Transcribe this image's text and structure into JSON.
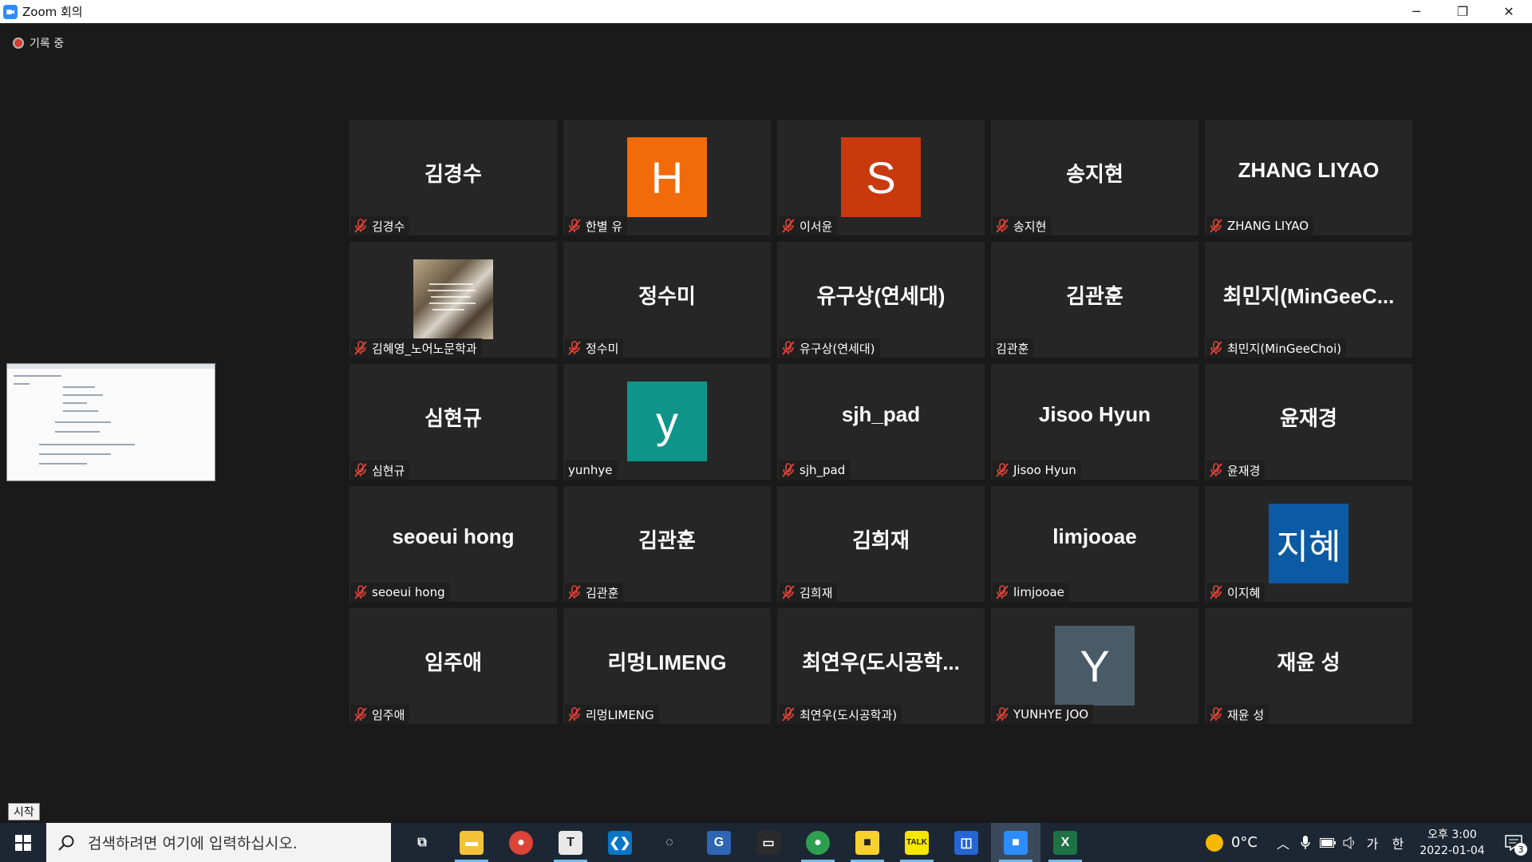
{
  "window": {
    "title": "Zoom 회의",
    "controls": {
      "minimize": "─",
      "restore": "❐",
      "close": "✕"
    }
  },
  "recording": {
    "label": "기록 중"
  },
  "tiles": [
    {
      "display": "김경수",
      "label": "김경수",
      "muted": true,
      "type": "name"
    },
    {
      "display": "H",
      "label": "한별 유",
      "muted": true,
      "type": "avatar",
      "color": "#f26b0b"
    },
    {
      "display": "S",
      "label": "이서윤",
      "muted": true,
      "type": "avatar",
      "color": "#c8390e"
    },
    {
      "display": "송지현",
      "label": "송지현",
      "muted": true,
      "type": "name"
    },
    {
      "display": "ZHANG LIYAO",
      "label": "ZHANG LIYAO",
      "muted": true,
      "type": "name"
    },
    {
      "display": "",
      "label": "김혜영_노어노문학과",
      "muted": true,
      "type": "photo"
    },
    {
      "display": "정수미",
      "label": "정수미",
      "muted": true,
      "type": "name"
    },
    {
      "display": "유구상(연세대)",
      "label": "유구상(연세대)",
      "muted": true,
      "type": "name"
    },
    {
      "display": "김관훈",
      "label": "김관훈",
      "muted": false,
      "type": "name"
    },
    {
      "display": "최민지(MinGeeC...",
      "label": "최민지(MinGeeChoi)",
      "muted": true,
      "type": "name"
    },
    {
      "display": "심현규",
      "label": "심현규",
      "muted": true,
      "type": "name"
    },
    {
      "display": "y",
      "label": "yunhye",
      "muted": false,
      "type": "avatar",
      "color": "#0e9488"
    },
    {
      "display": "sjh_pad",
      "label": "sjh_pad",
      "muted": true,
      "type": "name"
    },
    {
      "display": "Jisoo Hyun",
      "label": "Jisoo Hyun",
      "muted": true,
      "type": "name"
    },
    {
      "display": "윤재경",
      "label": "윤재경",
      "muted": true,
      "type": "name"
    },
    {
      "display": "seoeui hong",
      "label": "seoeui hong",
      "muted": true,
      "type": "name"
    },
    {
      "display": "김관훈",
      "label": "김관훈",
      "muted": true,
      "type": "name"
    },
    {
      "display": "김희재",
      "label": "김희재",
      "muted": true,
      "type": "name"
    },
    {
      "display": "limjooae",
      "label": "limjooae",
      "muted": true,
      "type": "name"
    },
    {
      "display": "지혜",
      "label": "이지혜",
      "muted": true,
      "type": "avatar",
      "color": "#0b5aa3"
    },
    {
      "display": "임주애",
      "label": "임주애",
      "muted": true,
      "type": "name"
    },
    {
      "display": "리멍LIMENG",
      "label": "리멍LIMENG",
      "muted": true,
      "type": "name"
    },
    {
      "display": "최연우(도시공학...",
      "label": "최연우(도시공학과)",
      "muted": true,
      "type": "name"
    },
    {
      "display": "Y",
      "label": "YUNHYE JOO",
      "muted": true,
      "type": "avatar",
      "color": "#4a5b68"
    },
    {
      "display": "재윤 성",
      "label": "재윤 성",
      "muted": true,
      "type": "name"
    }
  ],
  "tooltip": {
    "text": "시작"
  },
  "taskbar": {
    "search_placeholder": "검색하려면 여기에 입력하십시오.",
    "apps": [
      {
        "name": "task-view",
        "glyph": "⧉",
        "color": "transparent",
        "active": false
      },
      {
        "name": "file-explorer",
        "glyph": "▬",
        "color": "#f2c23a",
        "active": true
      },
      {
        "name": "chrome",
        "glyph": "●",
        "color": "#db4437",
        "active": false
      },
      {
        "name": "typora",
        "glyph": "T",
        "color": "#e9e9e9",
        "active": true
      },
      {
        "name": "vscode",
        "glyph": "❮❯",
        "color": "#0a74c7",
        "active": false
      },
      {
        "name": "jupyter",
        "glyph": "◌",
        "color": "transparent",
        "active": false
      },
      {
        "name": "gpa-app",
        "glyph": "G",
        "color": "#2f66b3",
        "active": false
      },
      {
        "name": "terminal",
        "glyph": "▭",
        "color": "#2b2b2b",
        "active": false
      },
      {
        "name": "chrome-profile",
        "glyph": "●",
        "color": "#2e9e4f",
        "active": true
      },
      {
        "name": "sticky-notes",
        "glyph": "■",
        "color": "#f8d12f",
        "active": true
      },
      {
        "name": "kakaotalk",
        "glyph": "TALK",
        "color": "#f7e600",
        "active": true
      },
      {
        "name": "remote-app",
        "glyph": "◫",
        "color": "#2565d4",
        "active": false
      },
      {
        "name": "zoom",
        "glyph": "■",
        "color": "#2d8cff",
        "active": true
      },
      {
        "name": "excel",
        "glyph": "X",
        "color": "#1f7246",
        "active": true
      }
    ],
    "weather": {
      "temp": "0°C"
    },
    "tray": {
      "ime": "가",
      "lang": "한"
    },
    "clock": {
      "time": "오후 3:00",
      "date": "2022-01-04"
    },
    "notifications": {
      "count": "3"
    }
  }
}
